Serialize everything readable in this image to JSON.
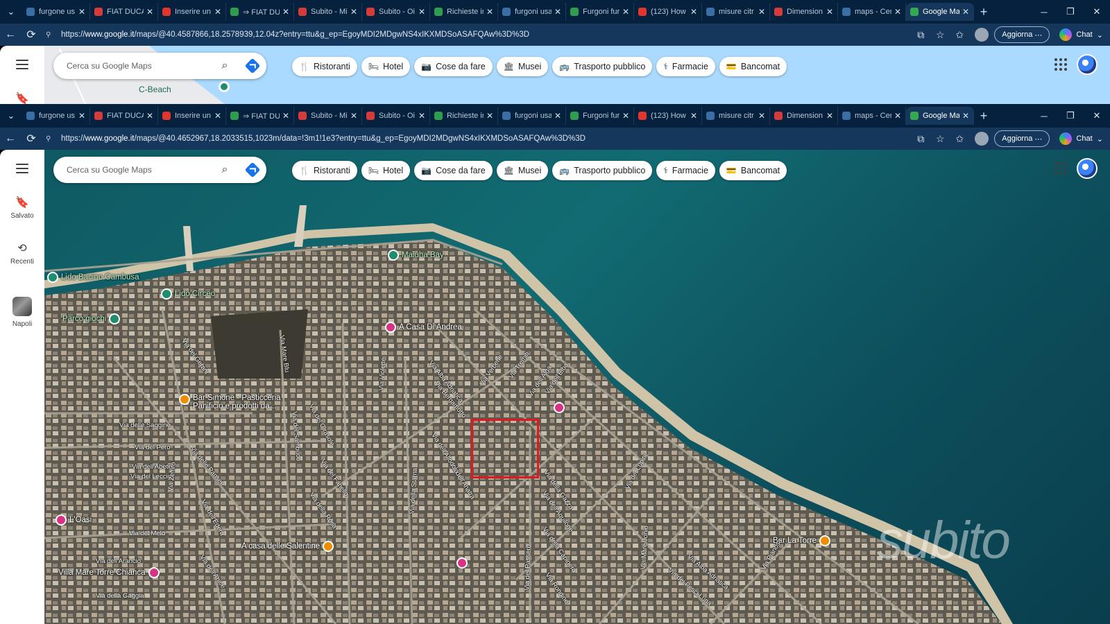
{
  "tabs": [
    {
      "title": "furgone us",
      "color": "#3b6ea5"
    },
    {
      "title": "FIAT DUCAT",
      "color": "#d63b3b"
    },
    {
      "title": "Inserire un",
      "color": "#e0362d"
    },
    {
      "title": "⇒ FIAT DUC",
      "color": "#2e9d4f"
    },
    {
      "title": "Subito - Mi",
      "color": "#d63b3b"
    },
    {
      "title": "Subito - Oi",
      "color": "#d63b3b"
    },
    {
      "title": "Richieste in",
      "color": "#2e9d4f"
    },
    {
      "title": "furgoni usa",
      "color": "#3b6ea5"
    },
    {
      "title": "Furgoni fur",
      "color": "#2e9d4f"
    },
    {
      "title": "(123) How",
      "color": "#e0362d"
    },
    {
      "title": "misure citr",
      "color": "#3b6ea5"
    },
    {
      "title": "Dimension",
      "color": "#d63b3b"
    },
    {
      "title": "maps - Cer",
      "color": "#3b6ea5"
    },
    {
      "title": "Google Ma",
      "color": "#34a853",
      "active": true
    }
  ],
  "window1": {
    "url_prefix": "https://",
    "url_host": "www.google.it",
    "url_rest": "/maps/@40.4587866,18.2578939,12.04z?entry=ttu&g_ep=EgoyMDI2MDgwNS4xIKXMDSoASAFQAw%3D%3D",
    "beach_label": "C-Beach"
  },
  "window2": {
    "url_prefix": "https://",
    "url_host": "www.google.it",
    "url_rest": "/maps/@40.4652967,18.2033515,1023m/data=!3m1!1e3?entry=ttu&g_ep=EgoyMDI2MDgwNS4xIKXMDSoASAFQAw%3D%3D"
  },
  "browser": {
    "update_label": "Aggiorna",
    "chat_label": "Chat"
  },
  "maps": {
    "search_placeholder": "Cerca su Google Maps",
    "chips": [
      {
        "icon": "🍴",
        "label": "Ristoranti"
      },
      {
        "icon": "🛏",
        "label": "Hotel"
      },
      {
        "icon": "📷",
        "label": "Cose da fare"
      },
      {
        "icon": "🏛",
        "label": "Musei"
      },
      {
        "icon": "🚌",
        "label": "Trasporto pubblico"
      },
      {
        "icon": "⚕",
        "label": "Farmacie"
      },
      {
        "icon": "💳",
        "label": "Bancomat"
      }
    ],
    "sidebar": {
      "saved": "Salvato",
      "recent": "Recenti",
      "napoli": "Napoli"
    },
    "pois": [
      {
        "label": "Maluha Bay",
        "kind": "green"
      },
      {
        "label": "Lido Bacino Cambusa",
        "kind": "green"
      },
      {
        "label": "Lido Circeo",
        "kind": "green"
      },
      {
        "label": "Parco giochi",
        "kind": "green"
      },
      {
        "label": "A Casa Di Andrea",
        "kind": "pink"
      },
      {
        "label": "Bar Simone - Pasticceria",
        "kind": "orange"
      },
      {
        "label": "L'Oasi",
        "kind": "pink"
      },
      {
        "label": "A casa delle Salentine",
        "kind": "orange"
      },
      {
        "label": "Villa Mare Torre Chianca",
        "kind": "pink"
      },
      {
        "label": "Bar La Torre",
        "kind": "orange"
      }
    ],
    "bar_simone_line2": "Panificio e prodotti da...",
    "streets": [
      "Via del Gerani",
      "Via Mare Blu",
      "Via Violette",
      "Via Alba Adriatica",
      "Via Verbene",
      "Via Tremiti",
      "Via dell'Alga",
      "Via dell'Elba",
      "Via Bergamotto",
      "Via del Girasole",
      "Via del Sambuco",
      "Via delle Saggine",
      "Via del Pero",
      "Via dell'Abete",
      "Via del Leccio",
      "Via delle Pansee",
      "Via del Fanello",
      "Via della Rosa",
      "Via dell'Edera",
      "Via della Starna",
      "Via dell'Anatra",
      "Via dell'Allodola",
      "Via della Gazza",
      "Via dell'Aquilone",
      "Via della Capinera",
      "Via del Passero",
      "Via dei Lupini",
      "Via Mare Jonio",
      "Via Alba Adriatica",
      "Via del Melo",
      "Via dell'Arancio",
      "Via della Gaggia",
      "Via dell'Anice",
      "Via Zeffiro",
      "Via dei Pesci Luna",
      "Via Pianosa",
      "Via Rondine"
    ],
    "watermark": "subito"
  }
}
